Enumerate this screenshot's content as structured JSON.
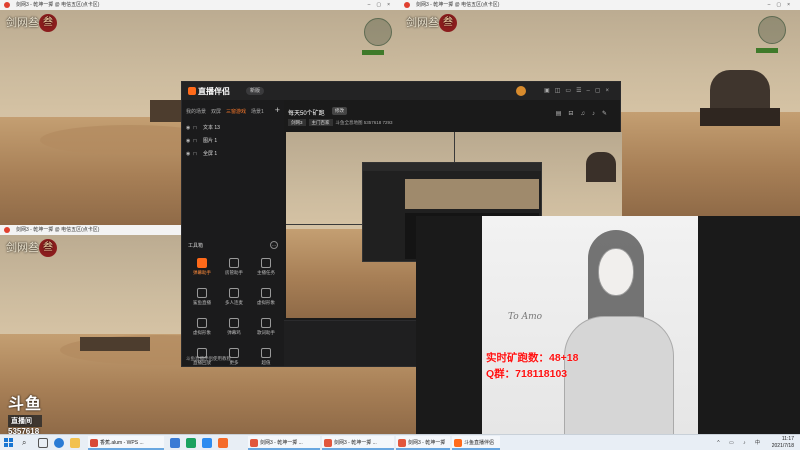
{
  "game_window_title": "剑网3 - 乾坤一掷 @ 电信五区(点卡区)",
  "game_logo_text": "剑网叁",
  "game_logo_seal": "叁",
  "app": {
    "name": "直播伴侣",
    "version_badge": "新版",
    "scene_tabs": [
      "我的场景",
      "双屏",
      "三窗游戏",
      "场景1"
    ],
    "active_scene_index": 2,
    "add_icon": "plus-icon",
    "sources": [
      "文本 13",
      "图片 1",
      "全屏 1"
    ],
    "tools_header": "工具箱",
    "tools": [
      {
        "label": "弹幕助手",
        "highlight": true
      },
      {
        "label": "房管助手",
        "highlight": false
      },
      {
        "label": "主播任务",
        "highlight": false
      },
      {
        "label": "鲨鱼直播",
        "highlight": false
      },
      {
        "label": "多人连麦",
        "highlight": false
      },
      {
        "label": "虚拟形象",
        "highlight": false
      },
      {
        "label": "虚拟形象",
        "highlight": false
      },
      {
        "label": "弹幕鸡",
        "highlight": false
      },
      {
        "label": "歌词助手",
        "highlight": false
      },
      {
        "label": "直播回放",
        "highlight": false
      },
      {
        "label": "更多",
        "highlight": false
      },
      {
        "label": "超值",
        "highlight": false
      }
    ],
    "notice": "斗鱼直播伴侣使用教程",
    "room_title": "每天50个矿跑",
    "room_badge": "修改",
    "room_chips": [
      "剑网3",
      "主门百家"
    ],
    "room_meta": "斗鱼全息地图   5357618   7293",
    "bottom_buttons": [
      "直播屏幕",
      "摄像头",
      "窗口"
    ]
  },
  "watermark": {
    "brand": "斗鱼",
    "tag": "直播间",
    "room_number": "5357618"
  },
  "portrait": {
    "signature": "To Amo",
    "stat_line_1": "实时矿跑数：48+18",
    "stat_line_2": "Q群：718118103"
  },
  "taskbar": {
    "items": [
      {
        "label": "香蕉.alum - WPS ...",
        "color": "#d94a38"
      },
      {
        "label": "剑网3 - 乾坤一掷 ...",
        "color": "#e2573d"
      },
      {
        "label": "剑网3 - 乾坤一掷 ...",
        "color": "#e2573d"
      },
      {
        "label": "剑网3 - 乾坤一掷 ...",
        "color": "#e2573d"
      },
      {
        "label": "斗鱼直播伴侣",
        "color": "#ff6a1a"
      }
    ],
    "time": "11:17",
    "date": "2021/7/18"
  }
}
